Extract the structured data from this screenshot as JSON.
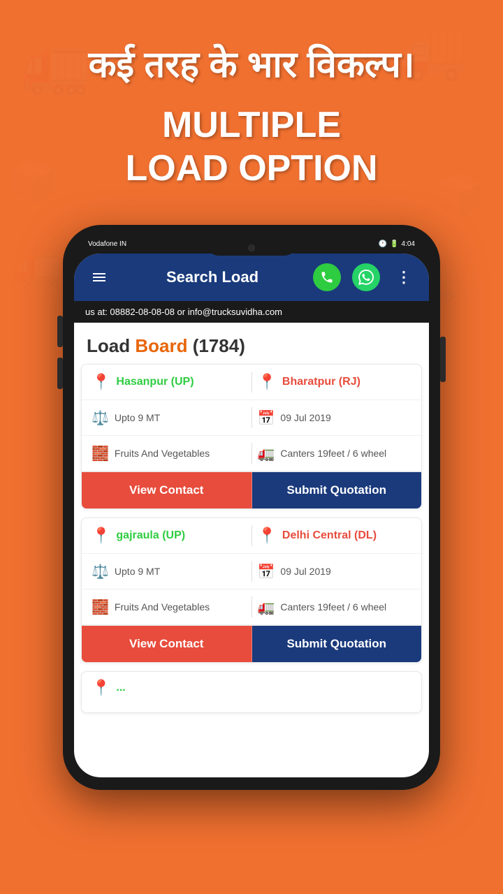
{
  "background_color": "#F07030",
  "header": {
    "hindi_title": "कई तरह के\nभार विकल्प।",
    "english_line1": "MULTIPLE",
    "english_line2": "LOAD OPTION"
  },
  "phone": {
    "status_bar": {
      "carrier": "Vodafone IN",
      "time": "4:04"
    },
    "app_bar": {
      "title": "Search Load",
      "icons": {
        "menu": "☰",
        "phone": "📞",
        "whatsapp": "W",
        "more": "⋮"
      }
    },
    "marquee_text": "us at: 08882-08-08-08 or info@trucksuvidha.com",
    "board_header": {
      "text_load": "Load ",
      "text_board": "Board",
      "text_count": " (1784)"
    },
    "load_cards": [
      {
        "id": 1,
        "from": "Hasanpur (UP)",
        "to": "Bharatpur (RJ)",
        "weight": "Upto 9 MT",
        "date": "09 Jul 2019",
        "goods": "Fruits And Vegetables",
        "vehicle": "Canters 19feet / 6 wheel",
        "btn_contact": "View Contact",
        "btn_quotation": "Submit Quotation"
      },
      {
        "id": 2,
        "from": "gajraula (UP)",
        "to": "Delhi Central (DL)",
        "weight": "Upto 9 MT",
        "date": "09 Jul 2019",
        "goods": "Fruits And Vegetables",
        "vehicle": "Canters 19feet / 6 wheel",
        "btn_contact": "View Contact",
        "btn_quotation": "Submit Quotation"
      }
    ]
  }
}
